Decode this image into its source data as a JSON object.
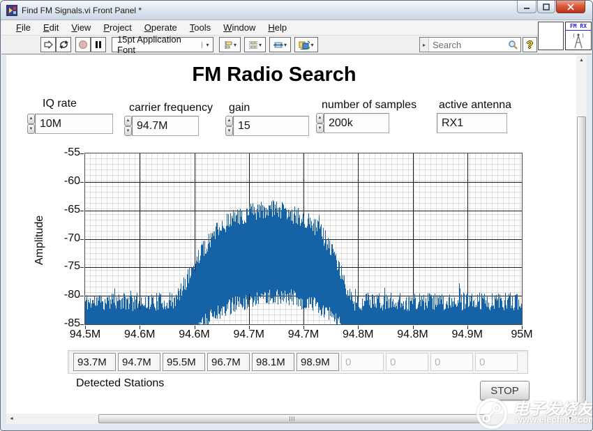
{
  "window": {
    "title": "Find FM Signals.vi Front Panel *"
  },
  "menu": {
    "items": [
      {
        "label": "File"
      },
      {
        "label": "Edit"
      },
      {
        "label": "View"
      },
      {
        "label": "Project"
      },
      {
        "label": "Operate"
      },
      {
        "label": "Tools"
      },
      {
        "label": "Window"
      },
      {
        "label": "Help"
      }
    ]
  },
  "toolbar": {
    "font_selector": "15pt Application Font",
    "search": {
      "placeholder": "Search"
    },
    "vi_icon_label": "FM RX"
  },
  "panel": {
    "title": "FM Radio Search",
    "controls": {
      "iq_rate": {
        "label": "IQ rate",
        "value": "10M"
      },
      "carrier_frequency": {
        "label": "carrier frequency",
        "value": "94.7M"
      },
      "gain": {
        "label": "gain",
        "value": "15"
      },
      "number_of_samples": {
        "label": "number of samples",
        "value": "200k"
      },
      "active_antenna": {
        "label": "active antenna",
        "value": "RX1"
      }
    },
    "detected_stations": {
      "label": "Detected Stations",
      "values": [
        "93.7M",
        "94.7M",
        "95.5M",
        "96.7M",
        "98.1M",
        "98.9M",
        "0",
        "0",
        "0",
        "0"
      ]
    },
    "stop_button_label": "STOP"
  },
  "chart_data": {
    "type": "line",
    "title": "",
    "ylabel": "Amplitude",
    "xlabel": "",
    "ylim": [
      -85,
      -55
    ],
    "y_ticks": [
      "-55",
      "-60",
      "-65",
      "-70",
      "-75",
      "-80",
      "-85"
    ],
    "x_ticks": [
      "94.5M",
      "94.6M",
      "94.6M",
      "94.7M",
      "94.7M",
      "94.8M",
      "94.8M",
      "94.9M",
      "95M"
    ],
    "xlim_hz": [
      94500000,
      95000000
    ],
    "grid": "major-and-minor",
    "line_color": "#1563a6",
    "noise_floor_db": -82,
    "peak_db": -63.5,
    "signal_center_hz": 94700000,
    "envelope_max_db": [
      [
        0.0,
        -81.5
      ],
      [
        0.205,
        -81.5
      ],
      [
        0.22,
        -79.5
      ],
      [
        0.24,
        -76.5
      ],
      [
        0.26,
        -73.5
      ],
      [
        0.285,
        -70.5
      ],
      [
        0.31,
        -68.3
      ],
      [
        0.335,
        -67.0
      ],
      [
        0.36,
        -66.3
      ],
      [
        0.39,
        -65.6
      ],
      [
        0.42,
        -65.1
      ],
      [
        0.45,
        -65.6
      ],
      [
        0.475,
        -66.2
      ],
      [
        0.5,
        -67.0
      ],
      [
        0.525,
        -68.2
      ],
      [
        0.545,
        -70.0
      ],
      [
        0.565,
        -72.5
      ],
      [
        0.58,
        -75.5
      ],
      [
        0.595,
        -78.5
      ],
      [
        0.61,
        -81.5
      ],
      [
        1.0,
        -81.5
      ]
    ],
    "envelope_min_db": [
      [
        0.0,
        -85
      ],
      [
        0.22,
        -85
      ],
      [
        0.26,
        -84.5
      ],
      [
        0.3,
        -83
      ],
      [
        0.34,
        -81.5
      ],
      [
        0.4,
        -80.3
      ],
      [
        0.47,
        -80.3
      ],
      [
        0.52,
        -81.5
      ],
      [
        0.56,
        -83.5
      ],
      [
        0.6,
        -85
      ],
      [
        1.0,
        -85
      ]
    ],
    "seed": 11
  },
  "watermark": {
    "title": "电子发烧友",
    "url": "www.elecfans.com"
  }
}
